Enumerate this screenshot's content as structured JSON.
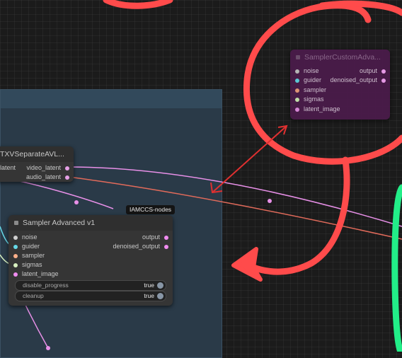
{
  "group": {
    "title": ""
  },
  "badge": {
    "label": "IAMCCS-nodes"
  },
  "ltx_node": {
    "title": "TXVSeparateAVL...",
    "input_label": "latent",
    "outputs": [
      {
        "label": "video_latent",
        "color": "#e6a0e6"
      },
      {
        "label": "audio_latent",
        "color": "#e6a0e6"
      }
    ]
  },
  "sampler_node": {
    "title": "Sampler Advanced v1",
    "inputs": [
      {
        "label": "noise",
        "color": "#cfcfcf"
      },
      {
        "label": "guider",
        "color": "#66d9e8"
      },
      {
        "label": "sampler",
        "color": "#ffb08a"
      },
      {
        "label": "sigmas",
        "color": "#d8f0c0"
      },
      {
        "label": "latent_image",
        "color": "#f08cf0"
      }
    ],
    "outputs": [
      {
        "label": "output",
        "color": "#f08cf0"
      },
      {
        "label": "denoised_output",
        "color": "#f08cf0"
      }
    ],
    "widgets": [
      {
        "label": "disable_progress",
        "value": "true"
      },
      {
        "label": "cleanup",
        "value": "true"
      }
    ]
  },
  "custom_node": {
    "title": "SamplerCustomAdva...",
    "inputs": [
      {
        "label": "noise",
        "color": "#bdbdbd"
      },
      {
        "label": "guider",
        "color": "#5fd0de"
      },
      {
        "label": "sampler",
        "color": "#e89a7a"
      },
      {
        "label": "sigmas",
        "color": "#c8e8b0"
      },
      {
        "label": "latent_image",
        "color": "#e08ce0"
      }
    ],
    "outputs": [
      {
        "label": "output",
        "color": "#f0a0f0"
      },
      {
        "label": "denoised_output",
        "color": "#f0a0f0"
      }
    ]
  },
  "colors": {
    "annotation_red": "#ff4b4b",
    "annotation_green": "#22ee88",
    "latent_link": "#e890e8",
    "audio_link": "#e06a5a"
  }
}
